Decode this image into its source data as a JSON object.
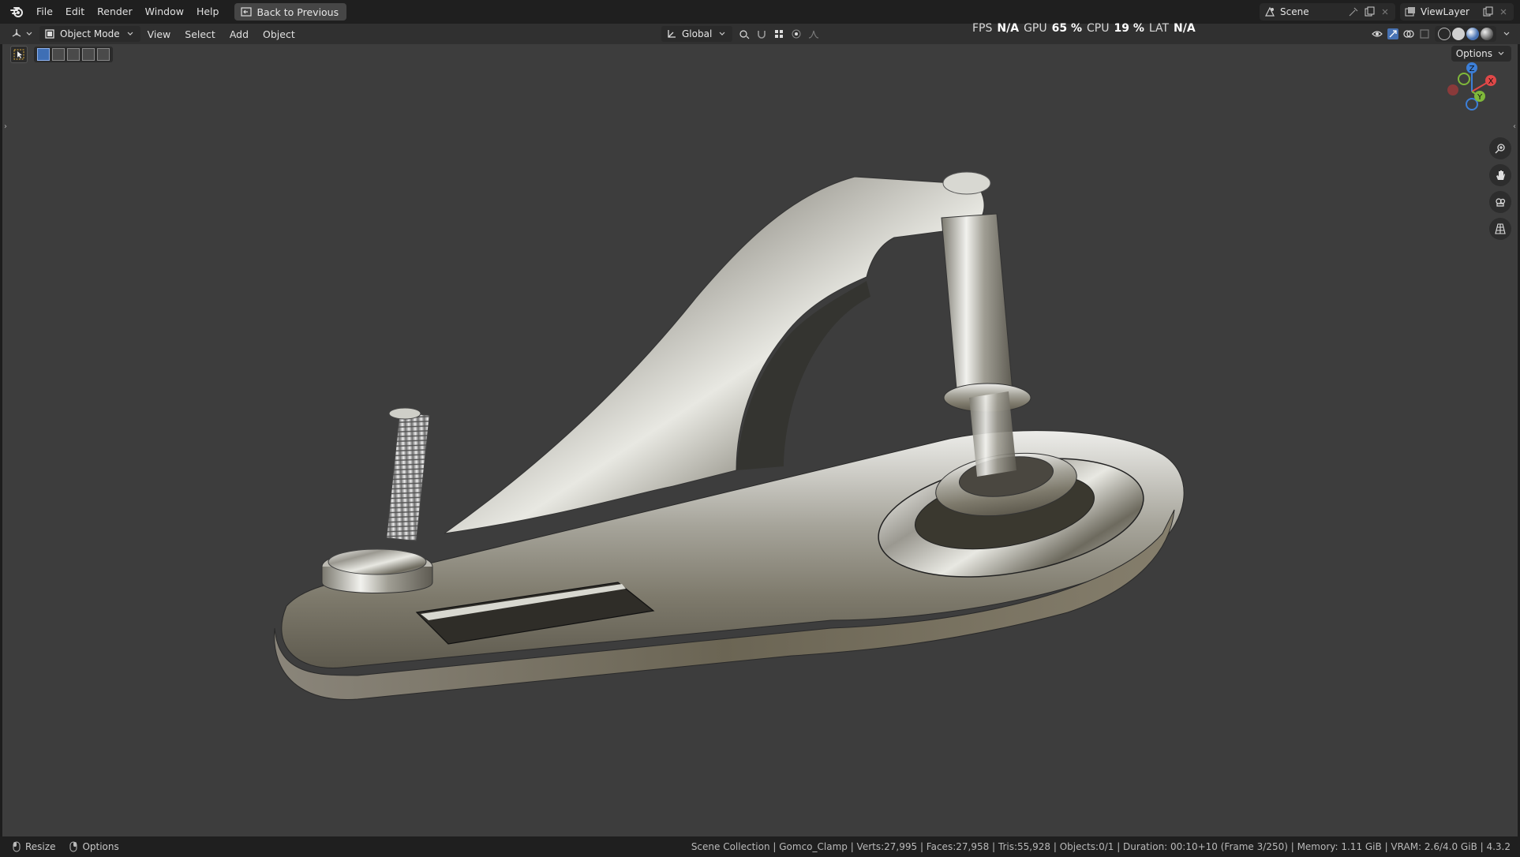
{
  "menubar": {
    "items": [
      "File",
      "Edit",
      "Render",
      "Window",
      "Help"
    ],
    "back_button": "Back to Previous"
  },
  "topright": {
    "scene": "Scene",
    "view_layer": "ViewLayer"
  },
  "header": {
    "mode": "Object Mode",
    "menus": [
      "View",
      "Select",
      "Add",
      "Object"
    ],
    "orientation": "Global",
    "options": "Options"
  },
  "stats": {
    "fps_label": "FPS",
    "fps_value": "N/A",
    "gpu_label": "GPU",
    "gpu_value": "65 %",
    "cpu_label": "CPU",
    "cpu_value": "19 %",
    "lat_label": "LAT",
    "lat_value": "N/A"
  },
  "gizmo": {
    "x": "X",
    "y": "Y",
    "z": "Z"
  },
  "statusbar": {
    "resize": "Resize",
    "options": "Options",
    "info": "Scene Collection | Gomco_Clamp | Verts:27,995 | Faces:27,958 | Tris:55,928 | Objects:0/1 | Duration: 00:10+10 (Frame 3/250) | Memory: 1.11 GiB | VRAM: 2.6/4.0 GiB | 4.3.2"
  },
  "colors": {
    "x_axis": "#e04848",
    "y_axis": "#7fb83a",
    "z_axis": "#3c7fd8",
    "accent": "#4772b3"
  }
}
